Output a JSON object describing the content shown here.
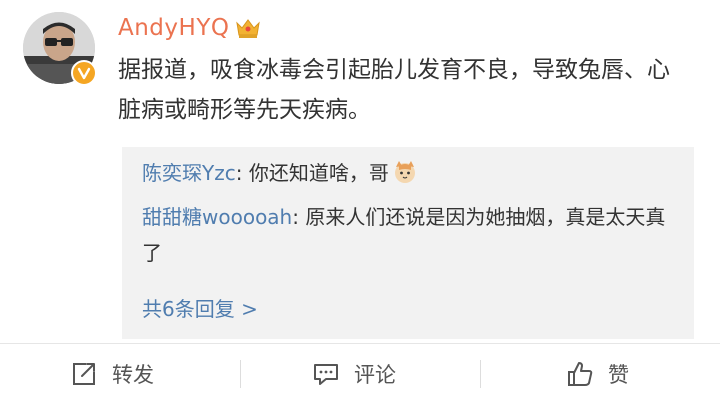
{
  "post": {
    "username": "AndyHYQ",
    "text": "据报道，吸食冰毒会引起胎儿发育不良，导致兔唇、心脏病或畸形等先天疾病。"
  },
  "replies": [
    {
      "author": "陈奕琛Yzc",
      "text": "你还知道啥，哥",
      "emoji": "cat-icon"
    },
    {
      "author": "甜甜糖wooooah",
      "text": "原来人们还说是因为她抽烟，真是太天真了"
    }
  ],
  "more_replies_label": "共6条回复 >",
  "actions": {
    "repost_label": "转发",
    "comment_label": "评论",
    "like_label": "赞"
  },
  "colors": {
    "username": "#eb7350",
    "link": "#507daf",
    "badge": "#f5a623"
  }
}
